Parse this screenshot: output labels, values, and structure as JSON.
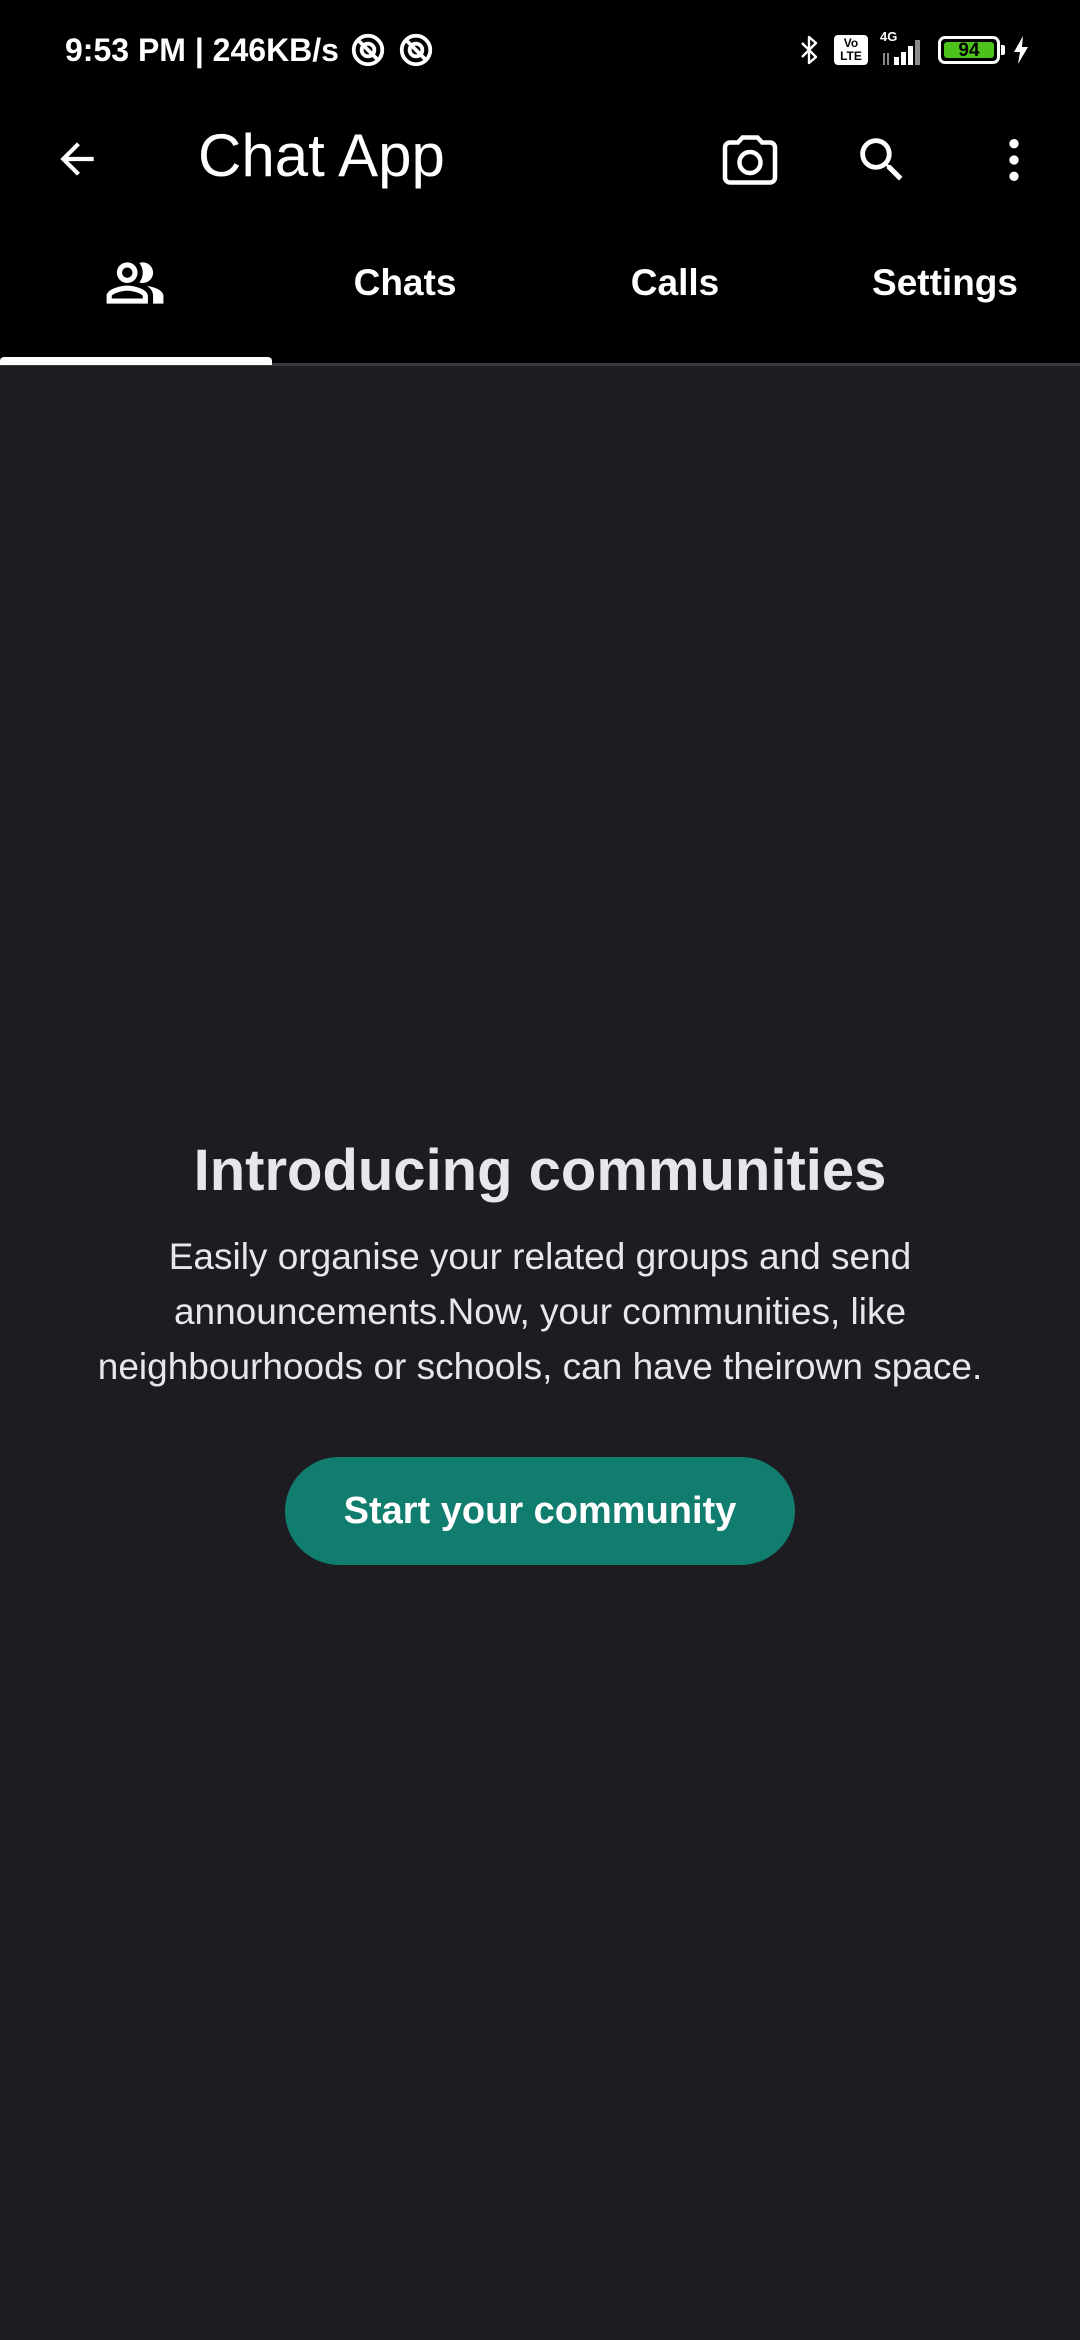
{
  "status_bar": {
    "time_speed": "9:53 PM | 246KB/s",
    "network": "4G",
    "volte": [
      "Vo",
      "LTE"
    ],
    "battery_percent": "94",
    "battery_level": 0.94
  },
  "app_bar": {
    "title": "Chat App",
    "icons": [
      "back-arrow-icon",
      "camera-icon",
      "search-icon",
      "more-vert-icon"
    ]
  },
  "tabs": {
    "communities_icon": "community-icon",
    "chats": "Chats",
    "calls": "Calls",
    "settings": "Settings",
    "selected": "communities"
  },
  "intro": {
    "title": "Introducing communities",
    "body_lines": [
      "Easily organise your related groups and send",
      "announcements.Now, your communities, like",
      "neighbourhoods or schools, can have theirown space."
    ],
    "button_label": "Start your community"
  },
  "colors": {
    "background": "#1d1c21",
    "app_bar": "#000000",
    "accent_button": "#117d6f",
    "battery": "#4cc21b"
  }
}
